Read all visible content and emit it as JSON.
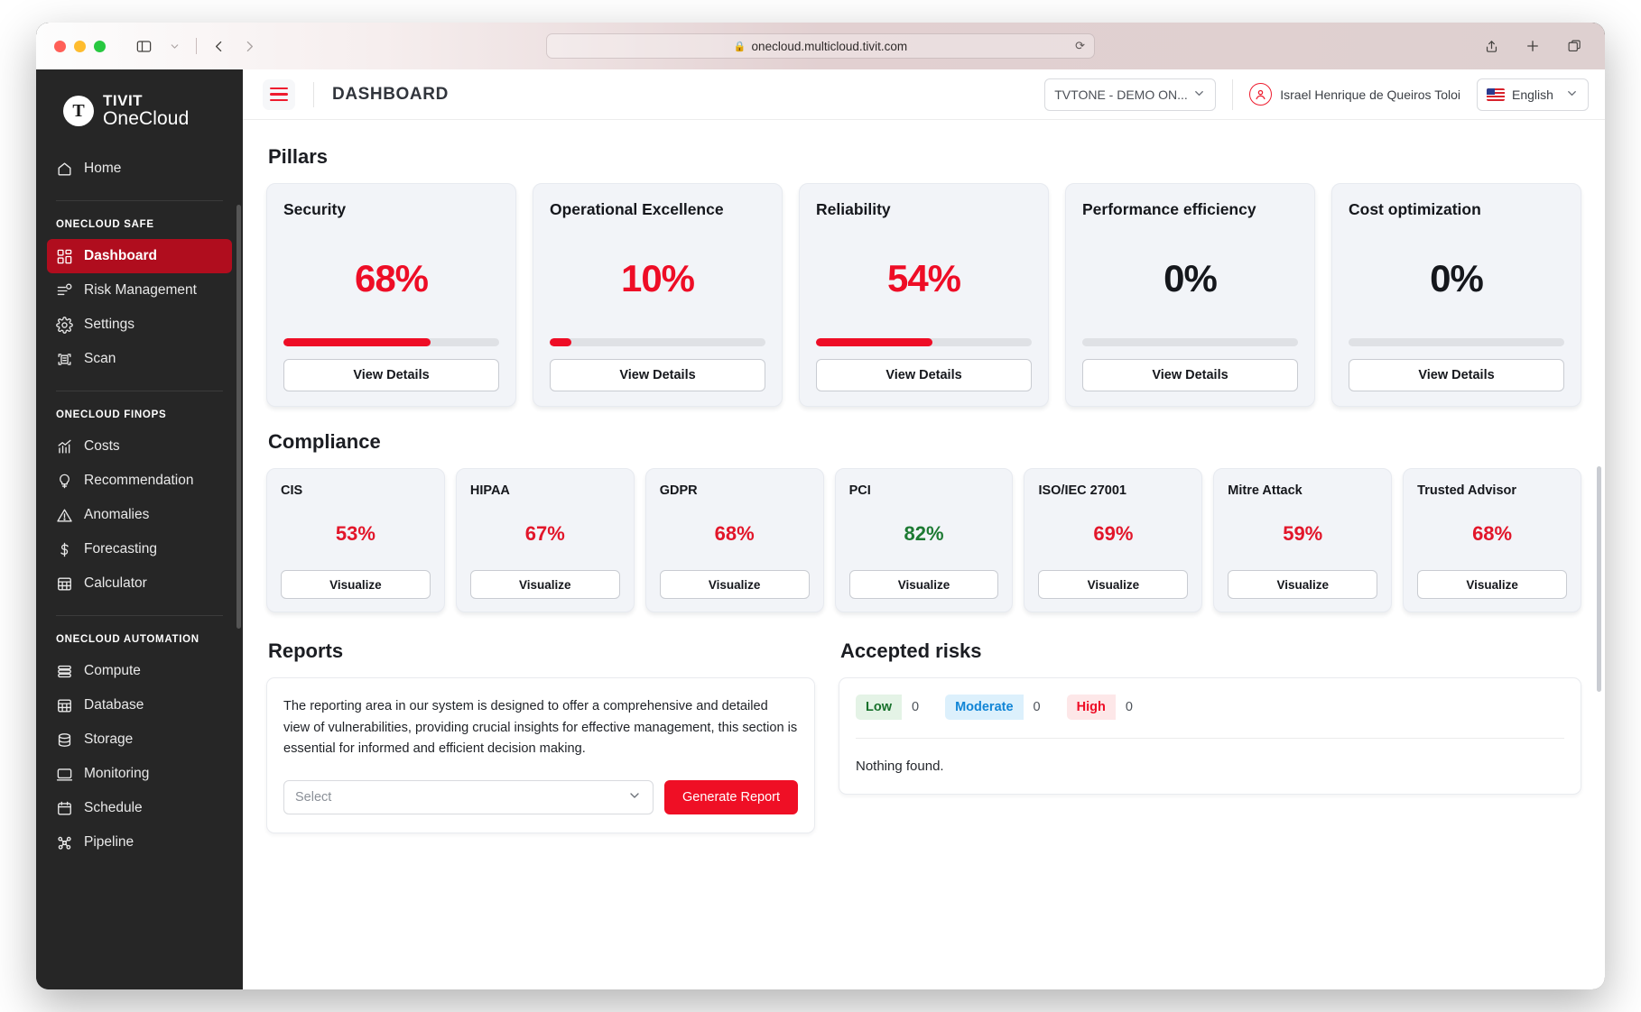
{
  "browser": {
    "url": "onecloud.multicloud.tivit.com",
    "lock_icon": "lock-icon",
    "reload_icon": "reload-icon",
    "back_icon": "back-chevron-icon",
    "forward_icon": "forward-chevron-icon",
    "sidebar_icon": "sidebar-toggle-icon",
    "tabs_overview_icon": "tab-overview-icon",
    "share_icon": "share-icon",
    "new_tab_icon": "new-tab-icon"
  },
  "sidebar": {
    "brand": {
      "line1": "TIVIT",
      "line2": "OneCloud",
      "mark": "T"
    },
    "home": {
      "label": "Home",
      "icon": "home-icon"
    },
    "groups": [
      {
        "label": "ONECLOUD SAFE",
        "items": [
          {
            "label": "Dashboard",
            "icon": "dashboard-grid-icon",
            "active": true
          },
          {
            "label": "Risk Management",
            "icon": "risk-list-icon",
            "active": false
          },
          {
            "label": "Settings",
            "icon": "gear-icon",
            "active": false
          },
          {
            "label": "Scan",
            "icon": "scan-document-icon",
            "active": false
          }
        ]
      },
      {
        "label": "ONECLOUD FINOPS",
        "items": [
          {
            "label": "Costs",
            "icon": "chart-bars-icon",
            "active": false
          },
          {
            "label": "Recommendation",
            "icon": "lightbulb-icon",
            "active": false
          },
          {
            "label": "Anomalies",
            "icon": "warning-triangle-icon",
            "active": false
          },
          {
            "label": "Forecasting",
            "icon": "dollar-icon",
            "active": false
          },
          {
            "label": "Calculator",
            "icon": "calculator-grid-icon",
            "active": false
          }
        ]
      },
      {
        "label": "ONECLOUD AUTOMATION",
        "items": [
          {
            "label": "Compute",
            "icon": "server-stack-icon",
            "active": false
          },
          {
            "label": "Database",
            "icon": "table-grid-icon",
            "active": false
          },
          {
            "label": "Storage",
            "icon": "database-cylinder-icon",
            "active": false
          },
          {
            "label": "Monitoring",
            "icon": "monitor-icon",
            "active": false
          },
          {
            "label": "Schedule",
            "icon": "calendar-icon",
            "active": false
          },
          {
            "label": "Pipeline",
            "icon": "pipeline-nodes-icon",
            "active": false
          }
        ]
      }
    ]
  },
  "topbar": {
    "menu_icon": "hamburger-menu-icon",
    "title": "DASHBOARD",
    "tenant": {
      "value": "TVTONE - DEMO ON...",
      "chevron": "chevron-down-icon"
    },
    "user": {
      "name": "Israel Henrique de Queiros Toloi",
      "avatar_icon": "user-avatar-icon"
    },
    "language": {
      "value": "English",
      "flag": "us-flag-icon",
      "chevron": "chevron-down-icon"
    }
  },
  "pillars": {
    "title": "Pillars",
    "button_label": "View Details",
    "cards": [
      {
        "name": "Security",
        "value": "68%",
        "percent": 68,
        "zero": false
      },
      {
        "name": "Operational Excellence",
        "value": "10%",
        "percent": 10,
        "zero": false
      },
      {
        "name": "Reliability",
        "value": "54%",
        "percent": 54,
        "zero": false
      },
      {
        "name": "Performance efficiency",
        "value": "0%",
        "percent": 0,
        "zero": true
      },
      {
        "name": "Cost optimization",
        "value": "0%",
        "percent": 0,
        "zero": true
      }
    ]
  },
  "compliance": {
    "title": "Compliance",
    "button_label": "Visualize",
    "cards": [
      {
        "name": "CIS",
        "value": "53%",
        "good": false
      },
      {
        "name": "HIPAA",
        "value": "67%",
        "good": false
      },
      {
        "name": "GDPR",
        "value": "68%",
        "good": false
      },
      {
        "name": "PCI",
        "value": "82%",
        "good": true
      },
      {
        "name": "ISO/IEC 27001",
        "value": "69%",
        "good": false
      },
      {
        "name": "Mitre Attack",
        "value": "59%",
        "good": false
      },
      {
        "name": "Trusted Advisor",
        "value": "68%",
        "good": false
      }
    ]
  },
  "reports": {
    "title": "Reports",
    "description": "The reporting area in our system is designed to offer a comprehensive and detailed view of vulnerabilities, providing crucial insights for effective management, this section is essential for informed and efficient decision making.",
    "select_placeholder": "Select",
    "select_chevron": "chevron-down-icon",
    "generate_label": "Generate Report"
  },
  "accepted_risks": {
    "title": "Accepted risks",
    "chips": [
      {
        "label": "Low",
        "count": "0",
        "tone": "low"
      },
      {
        "label": "Moderate",
        "count": "0",
        "tone": "mod"
      },
      {
        "label": "High",
        "count": "0",
        "tone": "high"
      }
    ],
    "empty_text": "Nothing found."
  },
  "colors": {
    "brand_red": "#ee0d26",
    "active_nav": "#b00d1e",
    "sidebar_bg": "#262626",
    "card_bg": "#f2f4f8",
    "good_green": "#1d7a33",
    "moderate_blue": "#1185d6"
  }
}
